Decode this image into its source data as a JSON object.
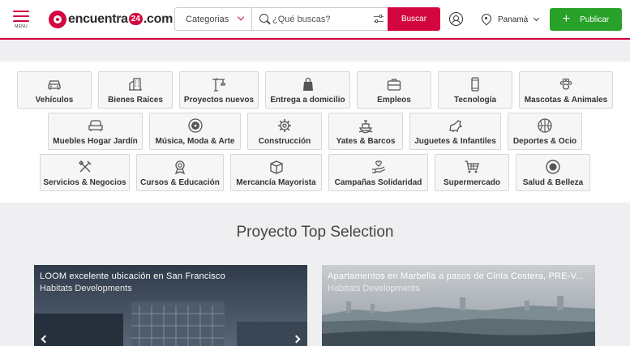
{
  "header": {
    "menu_label": "MENU",
    "logo": {
      "pre": "encuentra",
      "num": "24",
      "post": ".com"
    },
    "search": {
      "category_label": "Categorias",
      "placeholder": "¿Qué buscas?",
      "button_label": "Buscar"
    },
    "country": "Panamá",
    "publish_label": "Publicar",
    "colors": {
      "brand": "#d3073f",
      "publish": "#28a228"
    }
  },
  "categories": [
    {
      "label": "Vehículos",
      "icon": "car-icon"
    },
    {
      "label": "Bienes Raíces",
      "icon": "building-icon"
    },
    {
      "label": "Proyectos nuevos",
      "icon": "crane-icon"
    },
    {
      "label": "Entrega a domicilio",
      "icon": "shopping-bag-icon"
    },
    {
      "label": "Empleos",
      "icon": "briefcase-icon"
    },
    {
      "label": "Tecnología",
      "icon": "smartphone-icon"
    },
    {
      "label": "Mascotas & Animales",
      "icon": "paw-icon"
    },
    {
      "label": "Muebles Hogar Jardín",
      "icon": "sofa-icon"
    },
    {
      "label": "Música, Moda & Arte",
      "icon": "disc-icon"
    },
    {
      "label": "Construcción",
      "icon": "gear-icon"
    },
    {
      "label": "Yates & Barcos",
      "icon": "ship-icon"
    },
    {
      "label": "Juguetes & Infantiles",
      "icon": "toy-icon"
    },
    {
      "label": "Deportes & Ocio",
      "icon": "ball-icon"
    },
    {
      "label": "Servicios & Negocios",
      "icon": "tools-icon"
    },
    {
      "label": "Cursos & Educación",
      "icon": "award-icon"
    },
    {
      "label": "Mercancía Mayorista",
      "icon": "box-icon"
    },
    {
      "label": "Campañas Solidaridad",
      "icon": "hand-heart-icon"
    },
    {
      "label": "Supermercado",
      "icon": "cart-icon"
    },
    {
      "label": "Salud & Belleza",
      "icon": "circle-icon"
    }
  ],
  "section": {
    "title": "Proyecto Top Selection",
    "cards": [
      {
        "title": "LOOM excelente ubicación en San Francisco",
        "subtitle": "Habitats Developments"
      },
      {
        "title": "Apartamentos en Marbella a pasos de Cinta Costera, PRE-V...",
        "subtitle": "Habitats Developments"
      }
    ]
  }
}
